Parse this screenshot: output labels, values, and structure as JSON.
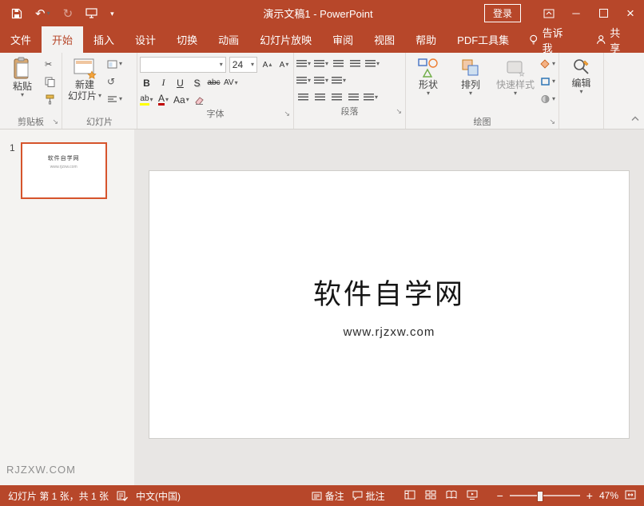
{
  "titlebar": {
    "title": "演示文稿1 - PowerPoint",
    "signin_label": "登录"
  },
  "ribbon_tabs": [
    "文件",
    "开始",
    "插入",
    "设计",
    "切换",
    "动画",
    "幻灯片放映",
    "审阅",
    "视图",
    "帮助",
    "PDF工具集"
  ],
  "tell_me_label": "告诉我",
  "share_label": "共享",
  "ribbon": {
    "clipboard": {
      "group_label": "剪贴板",
      "paste_label": "粘贴"
    },
    "slides": {
      "group_label": "幻灯片",
      "new_slide_line1": "新建",
      "new_slide_line2": "幻灯片"
    },
    "font": {
      "group_label": "字体",
      "font_name_value": "",
      "font_size_value": "24",
      "bold_glyph": "B",
      "italic_glyph": "I",
      "underline_glyph": "U",
      "shadow_glyph": "S",
      "strike_glyph": "abc",
      "spacing_glyph": "AV",
      "case_glyph": "Aa",
      "color_glyph": "A",
      "highlight_glyph": "ab",
      "grow_glyph": "A",
      "shrink_glyph": "A"
    },
    "paragraph": {
      "group_label": "段落"
    },
    "drawing": {
      "group_label": "绘图",
      "shapes_label": "形状",
      "arrange_label": "排列",
      "quick_styles_label": "快速样式"
    },
    "editing_label": "编辑"
  },
  "thumbnails": {
    "slide_number": "1",
    "thumb_title": "软件自学网",
    "thumb_subtitle": "www.rjzxw.com",
    "watermark": "RJZXW.COM"
  },
  "slide": {
    "title": "软件自学网",
    "subtitle": "www.rjzxw.com"
  },
  "statusbar": {
    "slide_info": "幻灯片 第 1 张，共 1 张",
    "language": "中文(中国)",
    "notes_label": "备注",
    "comments_label": "批注",
    "zoom_value": "47%"
  },
  "colors": {
    "accent": "#b7472a"
  }
}
